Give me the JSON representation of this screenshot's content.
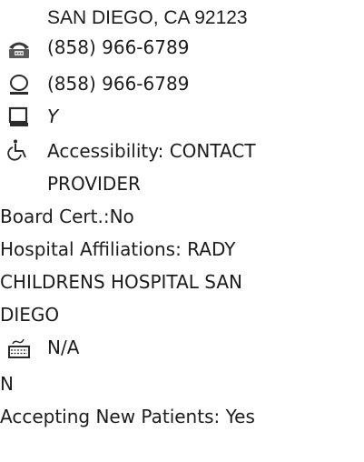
{
  "provider": {
    "address_line": "SAN DIEGO, CA 92123",
    "phone": "(858) 966-6789",
    "fax": "(858) 966-6789",
    "checkbox_value": "Y",
    "accessibility_line1": "Accessibility: CONTACT",
    "accessibility_line2": "PROVIDER",
    "board_cert": "Board Cert.:No",
    "hospital_line1": "Hospital Affiliations: RADY",
    "hospital_line2": "CHILDRENS HOSPITAL SAN",
    "hospital_line3": "DIEGO",
    "language": "N/A",
    "flag": "N",
    "accepting": "Accepting New Patients: Yes"
  },
  "icons": {
    "phone": "telephone-icon",
    "fax": "circle-icon",
    "checkbox": "checkbox-icon",
    "accessibility": "wheelchair-icon",
    "language": "keyboard-icon"
  }
}
